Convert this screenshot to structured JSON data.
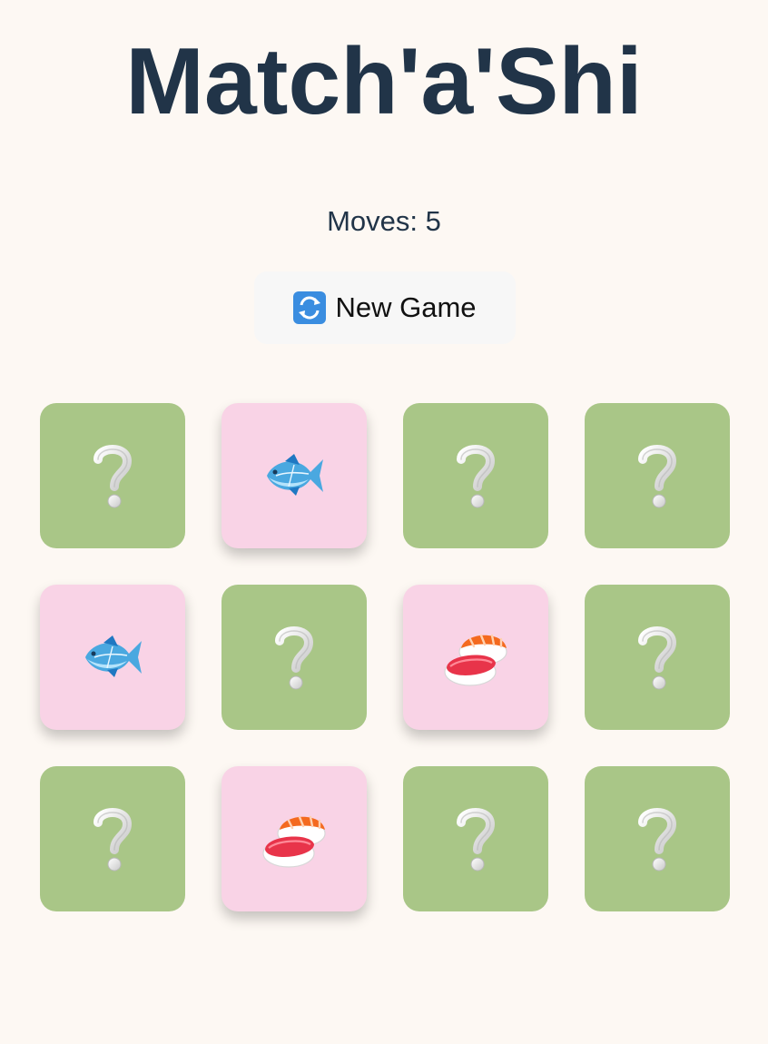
{
  "title": "Match'a'Shi",
  "moves": "Moves: 5",
  "new_game": {
    "icon": "refresh-icon",
    "label": "New Game"
  },
  "colors": {
    "background": "#fdf8f3",
    "title": "#213448",
    "card_hidden": "#a9c687",
    "card_revealed": "#f9d3e6",
    "button_bg": "#f7f7f7"
  },
  "cards": [
    {
      "state": "hidden",
      "icon": "question-mark-icon"
    },
    {
      "state": "revealed",
      "icon": "fish-icon"
    },
    {
      "state": "hidden",
      "icon": "question-mark-icon"
    },
    {
      "state": "hidden",
      "icon": "question-mark-icon"
    },
    {
      "state": "revealed",
      "icon": "fish-icon"
    },
    {
      "state": "hidden",
      "icon": "question-mark-icon"
    },
    {
      "state": "revealed",
      "icon": "sushi-icon"
    },
    {
      "state": "hidden",
      "icon": "question-mark-icon"
    },
    {
      "state": "hidden",
      "icon": "question-mark-icon"
    },
    {
      "state": "revealed",
      "icon": "sushi-icon"
    },
    {
      "state": "hidden",
      "icon": "question-mark-icon"
    },
    {
      "state": "hidden",
      "icon": "question-mark-icon"
    }
  ]
}
